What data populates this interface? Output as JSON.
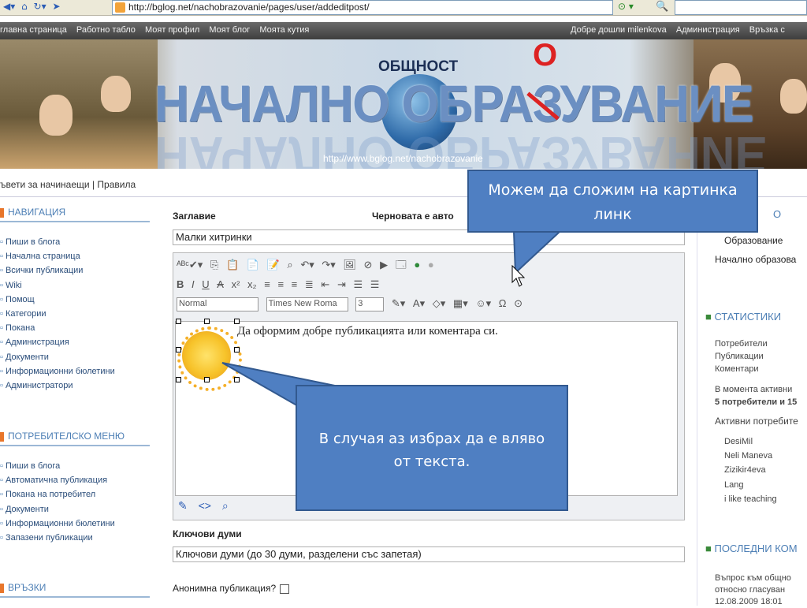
{
  "browser": {
    "url": "http://bglog.net/nachobrazovanie/pages/user/addeditpost/",
    "nav_icons": [
      "back-icon",
      "home-icon",
      "refresh-icon",
      "arrow-icon"
    ]
  },
  "menubar": {
    "left_items": [
      "главна страница",
      "Работно табло",
      "Моят профил",
      "Моят блог",
      "Моята кутия"
    ],
    "welcome": "Добре дошли milenkova",
    "right_items": [
      "Администрация",
      "Връзка с"
    ]
  },
  "banner": {
    "title": "НАЧАЛНО ОБРАЗУВАНИЕ",
    "subtitle": "ОБЩНОСТ",
    "correction_letter": "О",
    "url": "http://www.bglog.net/nachobrazovanie"
  },
  "breadcrumb": {
    "link1": "ъвети за начинаещи",
    "separator": "|",
    "link2": "Правила"
  },
  "left_sidebar": {
    "nav_title": "НАВИГАЦИЯ",
    "nav_items": [
      "Пиши в блога",
      "Начална страница",
      "Всички публикации",
      "Wiki",
      "Помощ",
      "Категории",
      "Покана",
      "Администрация",
      "Документи",
      "Информационни бюлетини",
      "Администратори"
    ],
    "user_menu_title": "ПОТРЕБИТЕЛСКО МЕНЮ",
    "user_menu_items": [
      "Пиши в блога",
      "Автоматична публикация",
      "Покана на потребител",
      "Документи",
      "Информационни бюлетини",
      "Запазени публикации"
    ],
    "links_title": "ВРЪЗКИ"
  },
  "form": {
    "title_label": "Заглавие",
    "draft_label": "Черновата е авто",
    "title_value": "Малки хитринки",
    "editor_text": "Да оформим добре публикацията или коментара си.",
    "font_style": "Normal",
    "font_family": "Times New Roma",
    "font_size": "3",
    "keywords_label": "Ключови думи",
    "keywords_placeholder": "Ключови думи (до 30 думи, разделени със запетая)",
    "anonymous_label": "Анонимна публикация?"
  },
  "right_sidebar": {
    "cat_title_tail": "О",
    "cat_item1": "Образование",
    "cat_item2": "Начално образова",
    "stats_title": "СТАТИСТИКИ",
    "stats_lines": [
      "Потребители",
      "Публикации",
      "Коментари"
    ],
    "active_now_line1": "В момента активни",
    "active_now_line2": "5 потребители и 15",
    "active_users_title": "Активни потребите",
    "active_users": [
      "DesiMil",
      "Neli Maneva",
      "Zizikir4eva",
      "Lang",
      "i like teaching"
    ],
    "recent_title": "ПОСЛЕДНИ КОМ",
    "recent_item1": "Въпрос към общно",
    "recent_item2": "относно гласуван",
    "recent_date": "12.08.2009 18:01"
  },
  "callouts": {
    "top_text": "Можем да сложим на картинка линк",
    "bottom_text": "В случая аз избрах да е вляво от текста."
  },
  "colors": {
    "callout_fill": "#4f7fc2",
    "sidebar_heading": "#4d7fb5",
    "menubar": "#4a4a4a"
  }
}
